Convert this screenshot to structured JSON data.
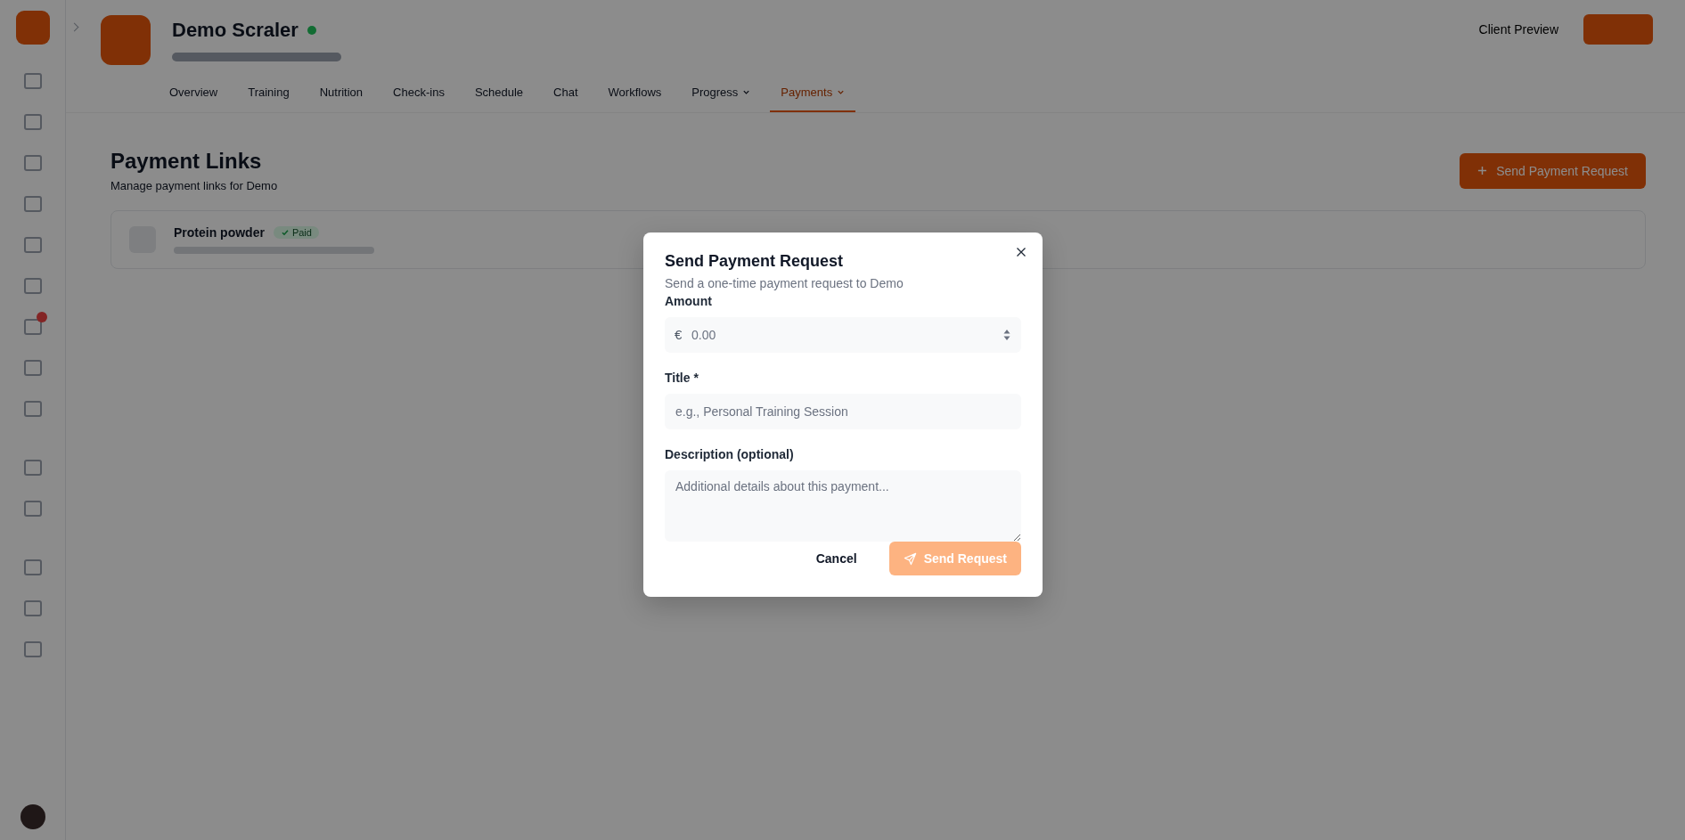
{
  "client": {
    "name": "Demo Scraler",
    "online": true
  },
  "tabs": [
    {
      "label": "Overview",
      "selected": false,
      "dropdown": false
    },
    {
      "label": "Training",
      "selected": false,
      "dropdown": false
    },
    {
      "label": "Nutrition",
      "selected": false,
      "dropdown": false
    },
    {
      "label": "Check-ins",
      "selected": false,
      "dropdown": false
    },
    {
      "label": "Schedule",
      "selected": false,
      "dropdown": false
    },
    {
      "label": "Chat",
      "selected": false,
      "dropdown": false
    },
    {
      "label": "Workflows",
      "selected": false,
      "dropdown": false
    },
    {
      "label": "Progress",
      "selected": false,
      "dropdown": true
    },
    {
      "label": "Payments",
      "selected": true,
      "dropdown": true
    }
  ],
  "header_actions": {
    "preview": "Client Preview"
  },
  "page": {
    "title": "Payment Links",
    "subtitle": "Manage payment links for Demo",
    "new_button": "Send Payment Request",
    "links": [
      {
        "title": "Protein powder",
        "status": "Paid"
      }
    ]
  },
  "dialog": {
    "title": "Send Payment Request",
    "subtitle": "Send a one-time payment request to Demo",
    "fields": [
      {
        "kind": "amount",
        "label": "Amount",
        "prefix": "€",
        "placeholder": "0.00"
      },
      {
        "kind": "text",
        "label": "Title *",
        "placeholder": "e.g., Personal Training Session"
      },
      {
        "kind": "textarea",
        "label": "Description (optional)",
        "placeholder": "Additional details about this payment..."
      }
    ],
    "cancel": "Cancel",
    "submit": {
      "label": "Send Request",
      "disabled": true
    }
  }
}
